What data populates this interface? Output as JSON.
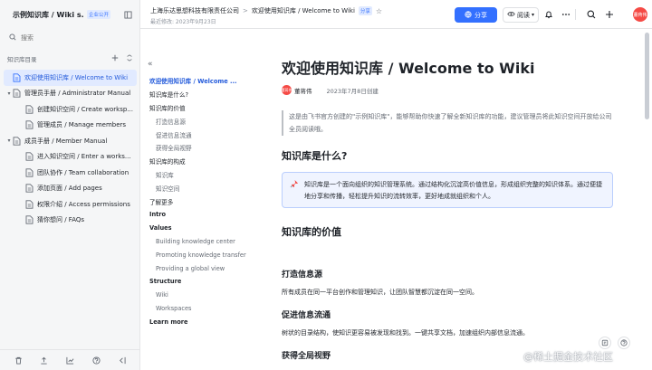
{
  "colors": {
    "accent": "#3370ff",
    "active_bg": "#e1eaff",
    "avatar": "#f54a45"
  },
  "sidebar": {
    "title": "示例知识库 / Wiki s...",
    "badge": "企业公开",
    "search_placeholder": "搜索",
    "section_label": "知识库目录",
    "items": [
      {
        "label": "欢迎使用知识库 / Welcome to Wiki",
        "level": 0,
        "arrow": "",
        "active": true
      },
      {
        "label": "管理员手册 / Administrator Manual",
        "level": 0,
        "arrow": "▾",
        "active": false
      },
      {
        "label": "创建知识空间 / Create worksp...",
        "level": 1,
        "arrow": "",
        "active": false
      },
      {
        "label": "管理成员 / Manage members",
        "level": 1,
        "arrow": "",
        "active": false
      },
      {
        "label": "成员手册 / Member Manual",
        "level": 0,
        "arrow": "▾",
        "active": false
      },
      {
        "label": "进入知识空间 / Enter a works...",
        "level": 1,
        "arrow": "",
        "active": false
      },
      {
        "label": "团队协作 / Team collaboration",
        "level": 1,
        "arrow": "",
        "active": false
      },
      {
        "label": "添加页面 / Add pages",
        "level": 1,
        "arrow": "",
        "active": false
      },
      {
        "label": "权限介绍 / Access permissions",
        "level": 1,
        "arrow": "",
        "active": false
      },
      {
        "label": "猜你想问 / FAQs",
        "level": 1,
        "arrow": "",
        "active": false
      }
    ],
    "footer_icons": [
      "trash-icon",
      "share-icon",
      "chart-icon",
      "help-icon",
      "collapse-icon"
    ]
  },
  "topbar": {
    "breadcrumb": [
      "上海乐达思想科技有限责任公司",
      "欢迎使用知识库 / Welcome to Wiki"
    ],
    "share_badge": "分享",
    "meta": "最近修改: 2023年9月23日",
    "share_label": "分享",
    "read_label": "阅读",
    "avatar_text": "董蒋伟"
  },
  "outline": {
    "items": [
      {
        "text": "欢迎使用知识库 / Welcome ...",
        "cls": "l1 current"
      },
      {
        "text": "知识库是什么?",
        "cls": "l2"
      },
      {
        "text": "知识库的价值",
        "cls": "l2"
      },
      {
        "text": "打造信息源",
        "cls": "l3"
      },
      {
        "text": "促进信息流通",
        "cls": "l3"
      },
      {
        "text": "获得全局视野",
        "cls": "l3"
      },
      {
        "text": "知识库的构成",
        "cls": "l2"
      },
      {
        "text": "知识库",
        "cls": "l3"
      },
      {
        "text": "知识空间",
        "cls": "l3"
      },
      {
        "text": "了解更多",
        "cls": "l2"
      },
      {
        "text": "Intro",
        "cls": "l1"
      },
      {
        "text": "Values",
        "cls": "l1"
      },
      {
        "text": "Building knowledge center",
        "cls": "l3"
      },
      {
        "text": "Promoting knowledge transfer",
        "cls": "l3"
      },
      {
        "text": "Providing a global view",
        "cls": "l3"
      },
      {
        "text": "Structure",
        "cls": "l1"
      },
      {
        "text": "Wiki",
        "cls": "l3"
      },
      {
        "text": "Workspaces",
        "cls": "l3"
      },
      {
        "text": "Learn more",
        "cls": "l1"
      }
    ]
  },
  "doc": {
    "title": "欢迎使用知识库 / Welcome to Wiki",
    "author": "董蒋伟",
    "author_avatar": "董蒋伟",
    "date": "2023年7月8日创建",
    "quote": "这是由飞书官方创建的\"示例知识库\"，能够帮助你快速了解全新知识库的功能，建议管理员将此知识空间开放给公司全员阅读哦。",
    "h_what": "知识库是什么?",
    "callout": "知识库是一个面向组织的知识管理系统。通过结构化沉淀高价值信息，形成组织完整的知识体系。通过便捷地分享和传播，轻松提升知识的流转效率，更好地成就组织和个人。",
    "h_value": "知识库的价值",
    "h_source": "打造信息源",
    "p_source": "所有成员在同一平台创作和管理知识，让团队智慧都沉淀在同一空间。",
    "h_flow": "促进信息流通",
    "p_flow": "树状的目录结构，使知识更容易被发现和找到。一键共享文档，加速组织内部信息流通。",
    "h_view": "获得全局视野"
  },
  "watermark": "@稀土掘金技术社区"
}
